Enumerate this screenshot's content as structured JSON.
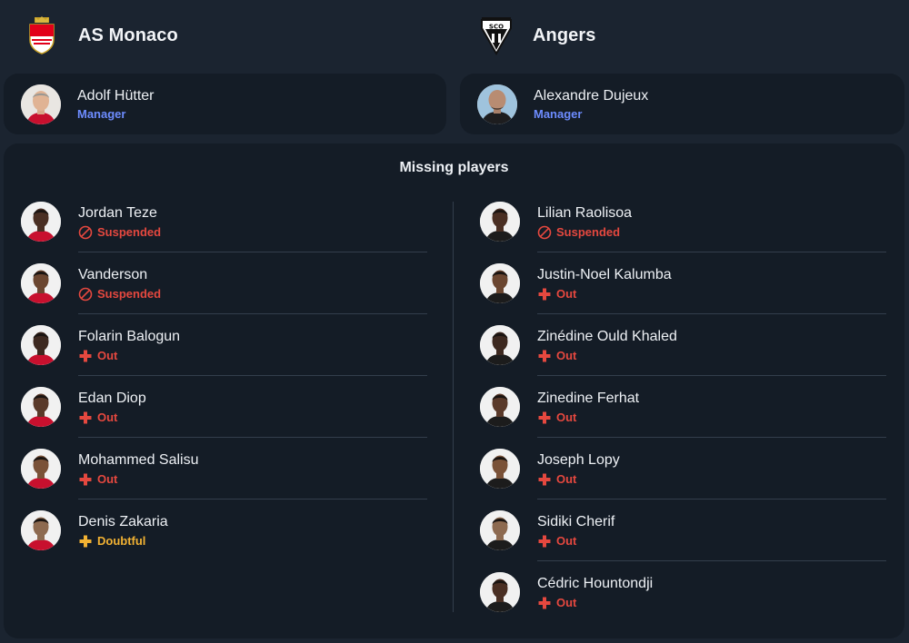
{
  "colors": {
    "background": "#1b2430",
    "card": "#141c26",
    "role": "#6d8cff",
    "suspended": "#e5483f",
    "out": "#e5483f",
    "doubtful": "#f2b233"
  },
  "home": {
    "team_name": "AS Monaco",
    "crest_icon": "as-monaco-crest-icon",
    "manager": {
      "name": "Adolf Hütter",
      "role": "Manager"
    }
  },
  "away": {
    "team_name": "Angers",
    "crest_icon": "angers-sco-crest-icon",
    "manager": {
      "name": "Alexandre Dujeux",
      "role": "Manager"
    }
  },
  "missing": {
    "title": "Missing players",
    "home_players": [
      {
        "name": "Jordan Teze",
        "status": "Suspended",
        "kind": "suspended"
      },
      {
        "name": "Vanderson",
        "status": "Suspended",
        "kind": "suspended"
      },
      {
        "name": "Folarin Balogun",
        "status": "Out",
        "kind": "out"
      },
      {
        "name": "Edan Diop",
        "status": "Out",
        "kind": "out"
      },
      {
        "name": "Mohammed Salisu",
        "status": "Out",
        "kind": "out"
      },
      {
        "name": "Denis Zakaria",
        "status": "Doubtful",
        "kind": "doubtful"
      }
    ],
    "away_players": [
      {
        "name": "Lilian Raolisoa",
        "status": "Suspended",
        "kind": "suspended"
      },
      {
        "name": "Justin-Noel Kalumba",
        "status": "Out",
        "kind": "out"
      },
      {
        "name": "Zinédine Ould Khaled",
        "status": "Out",
        "kind": "out"
      },
      {
        "name": "Zinedine Ferhat",
        "status": "Out",
        "kind": "out"
      },
      {
        "name": "Joseph Lopy",
        "status": "Out",
        "kind": "out"
      },
      {
        "name": "Sidiki Cherif",
        "status": "Out",
        "kind": "out"
      },
      {
        "name": "Cédric Hountondji",
        "status": "Out",
        "kind": "out"
      }
    ]
  }
}
